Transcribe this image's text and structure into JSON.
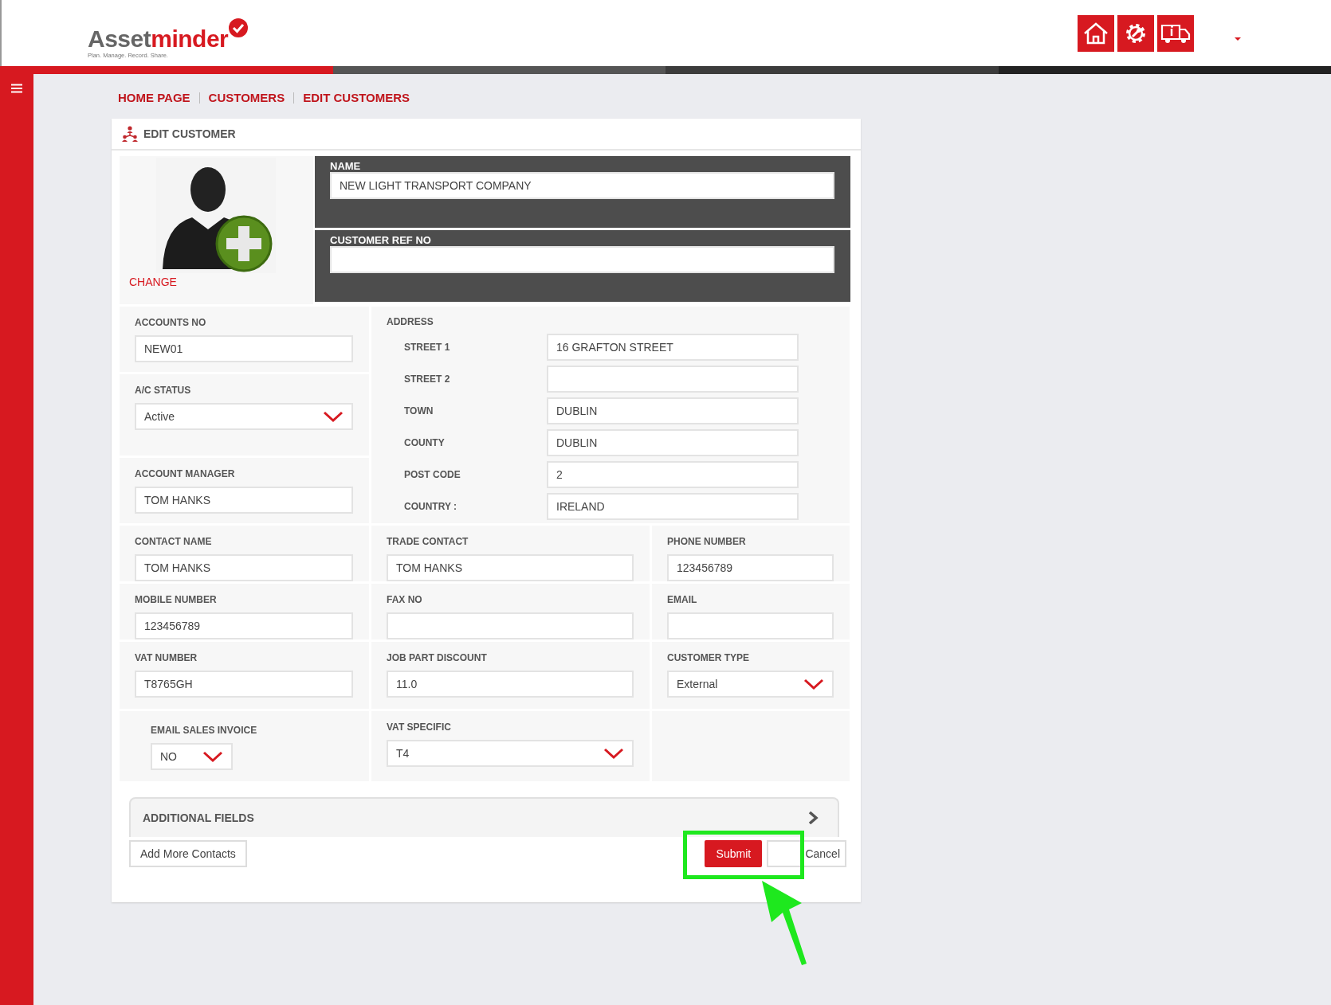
{
  "header": {
    "logo_primary": "Asset",
    "logo_accent": "minder",
    "tagline": "Plan. Manage. Record. Share.",
    "toolbar": [
      {
        "kind": "home"
      },
      {
        "kind": "settings"
      },
      {
        "kind": "truck"
      }
    ]
  },
  "breadcrumbs": [
    "HOME PAGE",
    "CUSTOMERS",
    "EDIT CUSTOMERS"
  ],
  "card": {
    "title": "EDIT CUSTOMER",
    "photo_link": "CHANGE",
    "name": {
      "label": "NAME",
      "value": "NEW LIGHT TRANSPORT COMPANY"
    },
    "ref": {
      "label": "CUSTOMER REF NO"
    }
  },
  "left_fields": [
    {
      "label": "ACCOUNTS NO",
      "value": "NEW01",
      "kind": "text"
    },
    {
      "label": "A/C STATUS",
      "value": "Active",
      "kind": "select"
    },
    {
      "label": "ACCOUNT MANAGER",
      "value": "TOM HANKS",
      "kind": "text"
    }
  ],
  "address": {
    "label": "ADDRESS",
    "lines": [
      {
        "label": "STREET 1",
        "value": "16 GRAFTON STREET"
      },
      {
        "label": "STREET 2"
      },
      {
        "label": "TOWN",
        "value": "DUBLIN"
      },
      {
        "label": "COUNTY",
        "value": "DUBLIN"
      },
      {
        "label": "POST CODE",
        "value": "2"
      },
      {
        "label": "COUNTRY :",
        "value": "IRELAND"
      }
    ]
  },
  "rows": [
    [
      {
        "label": "CONTACT NAME",
        "value": "TOM HANKS",
        "kind": "text"
      },
      {
        "label": "TRADE CONTACT",
        "value": "TOM HANKS",
        "kind": "text"
      },
      {
        "label": "PHONE NUMBER",
        "value": "123456789",
        "kind": "text"
      }
    ],
    [
      {
        "label": "MOBILE NUMBER",
        "value": "123456789",
        "kind": "text"
      },
      {
        "label": "FAX NO",
        "kind": "text"
      },
      {
        "label": "EMAIL",
        "kind": "text"
      }
    ],
    [
      {
        "label": "VAT NUMBER",
        "value": "T8765GH",
        "kind": "text"
      },
      {
        "label": "JOB PART DISCOUNT",
        "value": "11.0",
        "kind": "text"
      },
      {
        "label": "CUSTOMER TYPE",
        "value": "External",
        "kind": "select"
      }
    ],
    [
      {
        "label": "EMAIL SALES INVOICE",
        "value": "NO",
        "kind": "compact-select"
      },
      {
        "label": "VAT SPECIFIC",
        "value": "T4",
        "kind": "select"
      }
    ]
  ],
  "additional_fields": {
    "label": "ADDITIONAL FIELDS",
    "expanded": false
  },
  "buttons": [
    {
      "label": "Add More Contacts",
      "kind": "extra"
    },
    {
      "label": "Submit",
      "kind": "primary"
    },
    {
      "label": "Cancel",
      "kind": "secondary"
    }
  ]
}
